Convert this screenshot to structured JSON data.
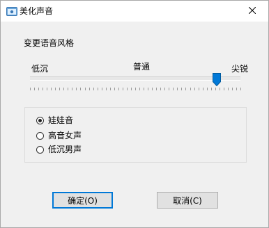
{
  "window": {
    "title": "美化声音",
    "icon": "app-window-icon",
    "close_icon": "close-icon"
  },
  "section": {
    "label": "变更语音风格"
  },
  "slider": {
    "min_label": "低沉",
    "mid_label": "普通",
    "max_label": "尖锐",
    "value_fraction": 0.89
  },
  "voices": {
    "options": [
      {
        "label": "娃娃音",
        "checked": true
      },
      {
        "label": "高音女声",
        "checked": false
      },
      {
        "label": "低沉男声",
        "checked": false
      }
    ]
  },
  "buttons": {
    "ok": "确定(O)",
    "cancel": "取消(C)"
  },
  "colors": {
    "accent": "#0078d7",
    "dialog_bg": "#f0f0f0"
  }
}
